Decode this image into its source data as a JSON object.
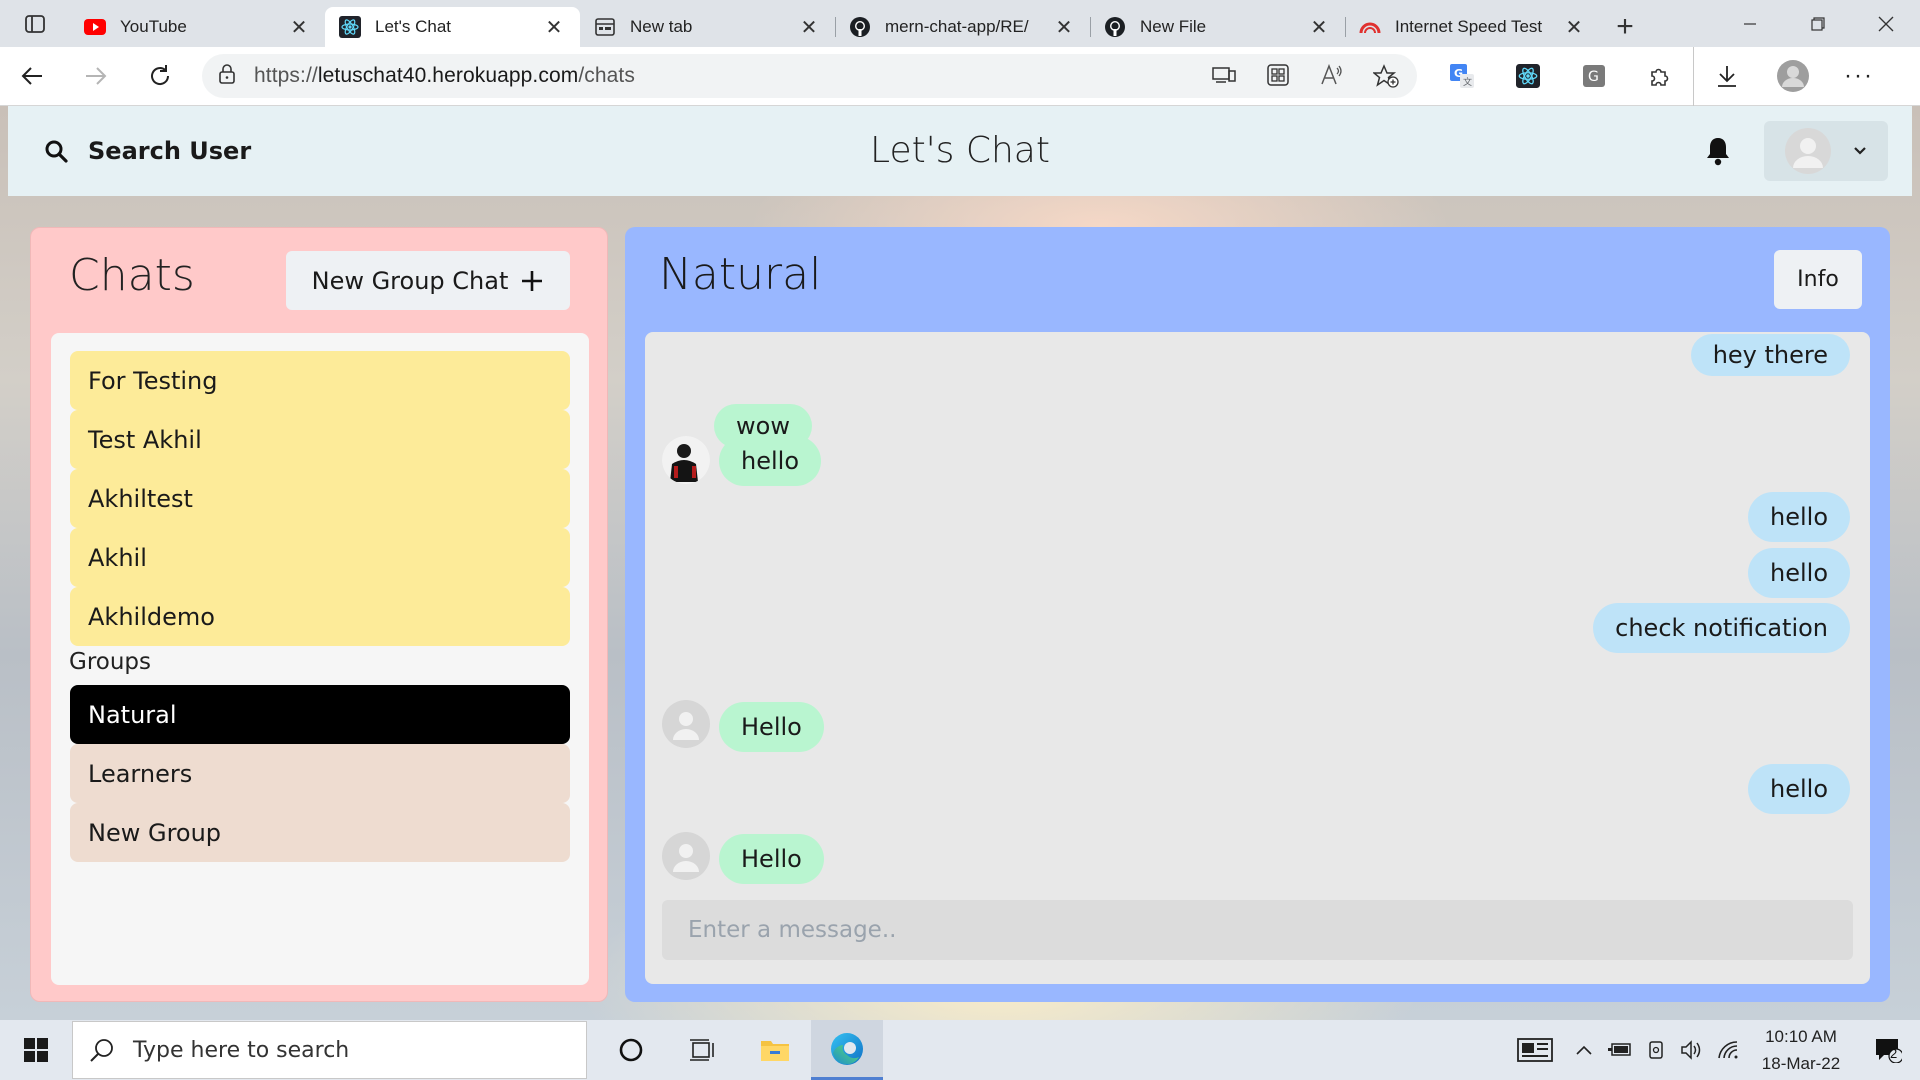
{
  "browser": {
    "tabs": [
      {
        "title": "YouTube",
        "icon": "youtube-icon",
        "active": false
      },
      {
        "title": "Let's Chat",
        "icon": "react-icon",
        "active": true
      },
      {
        "title": "New tab",
        "icon": "new-tab-page-icon",
        "active": false
      },
      {
        "title": "mern-chat-app/RE/",
        "icon": "github-icon",
        "active": false
      },
      {
        "title": "New File",
        "icon": "github-icon",
        "active": false
      },
      {
        "title": "Internet Speed Test",
        "icon": "speedometer-icon",
        "active": false
      }
    ],
    "url_prefix": "https://",
    "url_host": "letuschat40.herokuapp.com",
    "url_path": "/chats"
  },
  "header": {
    "search_label": "Search User",
    "title": "Let's Chat"
  },
  "chats": {
    "heading": "Chats",
    "new_group_label": "New Group Chat",
    "users": [
      "For Testing",
      "Test Akhil",
      "Akhiltest",
      "Akhil",
      "Akhildemo"
    ],
    "groups_label": "Groups",
    "groups": [
      "Natural",
      "Learners",
      "New Group"
    ],
    "selected": "Natural"
  },
  "conversation": {
    "title": "Natural",
    "info_label": "Info",
    "messages": [
      {
        "text": "hey there",
        "side": "sent"
      },
      {
        "text": "wow",
        "side": "recv"
      },
      {
        "text": "hello",
        "side": "recv",
        "avatar": "photo"
      },
      {
        "text": "hello",
        "side": "sent"
      },
      {
        "text": "hello",
        "side": "sent"
      },
      {
        "text": "check notification",
        "side": "sent"
      },
      {
        "text": "Hello",
        "side": "recv",
        "avatar": "default"
      },
      {
        "text": "hello",
        "side": "sent"
      },
      {
        "text": "Hello",
        "side": "recv",
        "avatar": "default"
      }
    ],
    "input_placeholder": "Enter a message.."
  },
  "taskbar": {
    "search_placeholder": "Type here to search",
    "time": "10:10 AM",
    "date": "18-Mar-22",
    "notification_count": "2"
  },
  "colors": {
    "chats_panel": "#ffc9c9",
    "user_item": "#fdeb99",
    "group_item": "#eedcd0",
    "selected_item": "#000000",
    "conv_panel": "#99b7ff",
    "sent_bubble": "#bee3f8",
    "recv_bubble": "#b9f5d0"
  }
}
